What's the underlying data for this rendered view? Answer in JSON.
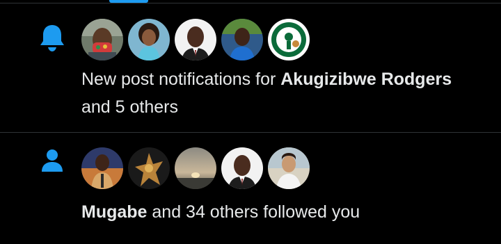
{
  "colors": {
    "background": "#000000",
    "accent": "#1d9bf0",
    "text": "#e7e9ea",
    "divider": "#2f3336"
  },
  "notifications": [
    {
      "type_icon": "bell-icon",
      "avatars": [
        "avatar-person-1",
        "avatar-person-2",
        "avatar-person-3",
        "avatar-person-4",
        "avatar-celtics-logo"
      ],
      "bold_name": "Akugizibwe Rodgers",
      "prefix": "New post notifications for ",
      "suffix": " and 5 others"
    },
    {
      "type_icon": "person-icon",
      "avatars": [
        "avatar-person-5",
        "avatar-statue",
        "avatar-sunset",
        "avatar-person-6",
        "avatar-person-7"
      ],
      "bold_name": "Mugabe",
      "prefix": "",
      "suffix": " and 34 others followed you"
    }
  ]
}
